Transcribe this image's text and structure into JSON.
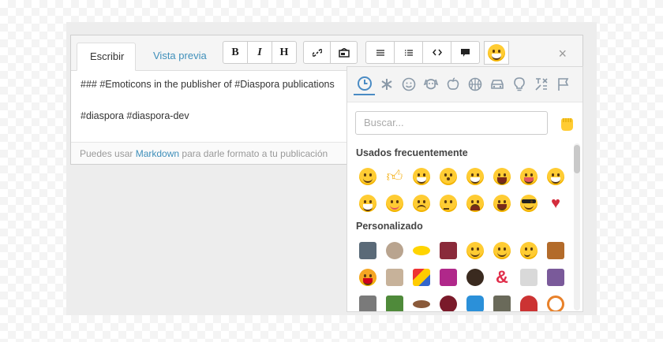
{
  "tabs": {
    "write": "Escribir",
    "preview": "Vista previa"
  },
  "toolbar": {
    "bold": "B",
    "italic": "I",
    "heading": "H",
    "close": "×"
  },
  "editor": {
    "line1": "### #Emoticons in the publisher of #Diaspora publications",
    "line2": "#diaspora #diaspora-dev"
  },
  "footer": {
    "before": "Puedes usar ",
    "link": "Markdown",
    "after": " para darle formato a tu publicación"
  },
  "picker": {
    "search_placeholder": "Buscar...",
    "frequent_title": "Usados frecuentemente",
    "custom_title": "Personalizado"
  },
  "colors": {
    "accent": "#3f8fba",
    "picker_tab": "#4a8bc4",
    "heart": "#d42d3d"
  }
}
